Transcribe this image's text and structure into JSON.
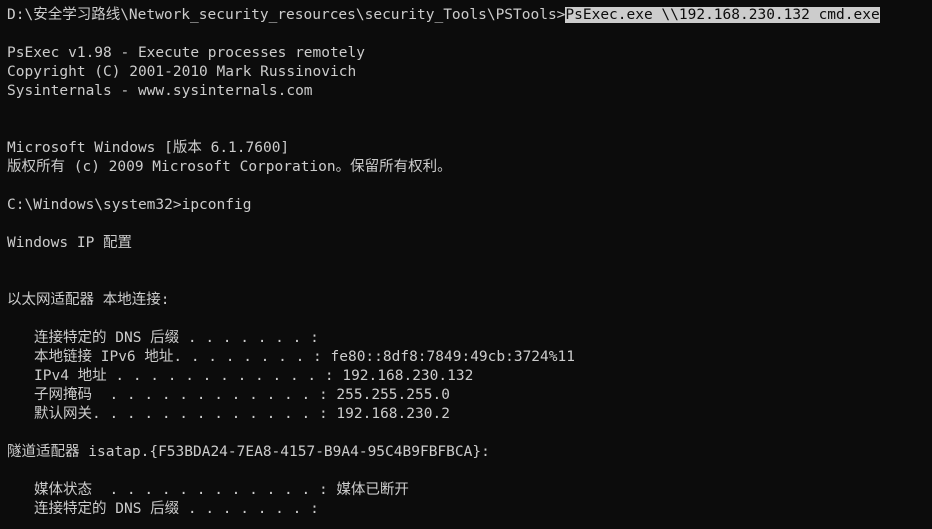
{
  "command": {
    "prompt": "D:\\安全学习路线\\Network_security_resources\\security_Tools\\PSTools>",
    "selected_text": "PsExec.exe \\\\192.168.230.132 cmd.exe"
  },
  "banner": {
    "title": "PsExec v1.98 - Execute processes remotely",
    "copyright": "Copyright (C) 2001-2010 Mark Russinovich",
    "site": "Sysinternals - www.sysinternals.com"
  },
  "remote": {
    "os_version": "Microsoft Windows [版本 6.1.7600]",
    "os_copyright": "版权所有 (c) 2009 Microsoft Corporation。保留所有权利。",
    "prompt_command": "C:\\Windows\\system32>ipconfig",
    "ip_config_title": "Windows IP 配置"
  },
  "adapter1": {
    "header": "以太网适配器 本地连接:",
    "dns_suffix": "连接特定的 DNS 后缀 . . . . . . . :",
    "ipv6": "本地链接 IPv6 地址. . . . . . . . : fe80::8df8:7849:49cb:3724%11",
    "ipv4": "IPv4 地址 . . . . . . . . . . . . : 192.168.230.132",
    "subnet": "子网掩码  . . . . . . . . . . . . : 255.255.255.0",
    "gateway": "默认网关. . . . . . . . . . . . . : 192.168.230.2"
  },
  "adapter2": {
    "header": "隧道适配器 isatap.{F53BDA24-7EA8-4157-B9A4-95C4B9FBFBCA}:",
    "media_state": "媒体状态  . . . . . . . . . . . . : 媒体已断开",
    "dns_suffix": "连接特定的 DNS 后缀 . . . . . . . :"
  }
}
